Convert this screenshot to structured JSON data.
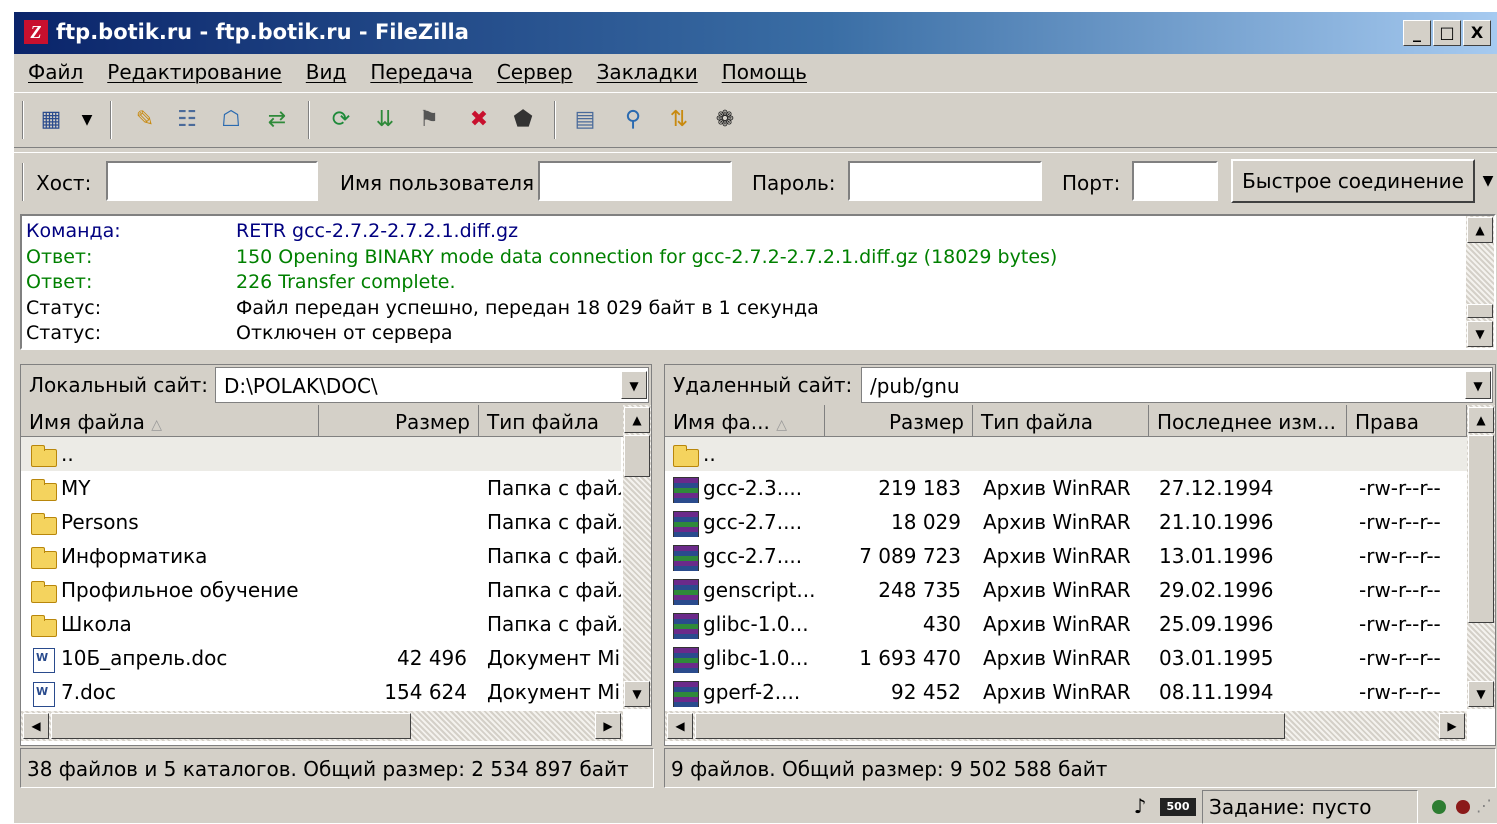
{
  "window": {
    "title": "ftp.botik.ru - ftp.botik.ru - FileZilla",
    "app_icon": "Z",
    "minimize": "_",
    "maximize": "□",
    "close": "X"
  },
  "menu": [
    "Файл",
    "Редактирование",
    "Вид",
    "Передача",
    "Сервер",
    "Закладки",
    "Помощь"
  ],
  "toolbar_icons": [
    "site-manager-icon",
    "dropdown-arrow-icon",
    "toggle-log-icon",
    "toggle-tree-icon",
    "toggle-remote-tree-icon",
    "toggle-queue-icon",
    "refresh-icon",
    "process-queue-icon",
    "cancel-icon",
    "disconnect-icon",
    "reconnect-icon",
    "filter-icon",
    "compare-icon",
    "sync-browse-icon",
    "search-icon"
  ],
  "quickconnect": {
    "host_label": "Хост:",
    "host_value": "",
    "user_label": "Имя пользователя",
    "user_value": "",
    "pass_label": "Пароль:",
    "pass_value": "",
    "port_label": "Порт:",
    "port_value": "",
    "button": "Быстрое соединение"
  },
  "log": [
    {
      "label": "Команда:",
      "msg": "RETR gcc-2.7.2-2.7.2.1.diff.gz",
      "color": "#000080"
    },
    {
      "label": "Ответ:",
      "msg": "150 Opening BINARY mode data connection for gcc-2.7.2-2.7.2.1.diff.gz (18029 bytes)",
      "color": "#008000"
    },
    {
      "label": "Ответ:",
      "msg": "226 Transfer complete.",
      "color": "#008000"
    },
    {
      "label": "Статус:",
      "msg": "Файл передан успешно, передан 18 029 байт в 1 секунда",
      "color": "#000000"
    },
    {
      "label": "Статус:",
      "msg": "Отключен от сервера",
      "color": "#000000"
    }
  ],
  "local": {
    "site_label": "Локальный сайт:",
    "path": "D:\\POLAK\\DOC\\",
    "columns": [
      "Имя файла",
      "Размер",
      "Тип файла"
    ],
    "rows": [
      {
        "icon": "folder",
        "name": "..",
        "size": "",
        "type": ""
      },
      {
        "icon": "folder",
        "name": "MY",
        "size": "",
        "type": "Папка с файл"
      },
      {
        "icon": "folder",
        "name": "Persons",
        "size": "",
        "type": "Папка с файл"
      },
      {
        "icon": "folder",
        "name": "Информатика",
        "size": "",
        "type": "Папка с файл"
      },
      {
        "icon": "folder",
        "name": "Профильное обучение",
        "size": "",
        "type": "Папка с файл"
      },
      {
        "icon": "folder",
        "name": "Школа",
        "size": "",
        "type": "Папка с файл"
      },
      {
        "icon": "doc",
        "name": "10Б_апрель.doc",
        "size": "42 496",
        "type": "Документ Mic"
      },
      {
        "icon": "doc",
        "name": "7.doc",
        "size": "154 624",
        "type": "Документ Mic"
      }
    ],
    "status": "38 файлов и 5 каталогов. Общий размер: 2 534 897 байт"
  },
  "remote": {
    "site_label": "Удаленный сайт:",
    "path": "/pub/gnu",
    "columns": [
      "Имя фа...",
      "Размер",
      "Тип файла",
      "Последнее изм...",
      "Права"
    ],
    "rows": [
      {
        "icon": "folder",
        "name": "..",
        "size": "",
        "type": "",
        "modified": "",
        "perms": ""
      },
      {
        "icon": "rar",
        "name": "gcc-2.3....",
        "size": "219 183",
        "type": "Архив WinRAR",
        "modified": "27.12.1994",
        "perms": "-rw-r--r--"
      },
      {
        "icon": "rar",
        "name": "gcc-2.7....",
        "size": "18 029",
        "type": "Архив WinRAR",
        "modified": "21.10.1996",
        "perms": "-rw-r--r--"
      },
      {
        "icon": "rar",
        "name": "gcc-2.7....",
        "size": "7 089 723",
        "type": "Архив WinRAR",
        "modified": "13.01.1996",
        "perms": "-rw-r--r--"
      },
      {
        "icon": "rar",
        "name": "genscript...",
        "size": "248 735",
        "type": "Архив WinRAR",
        "modified": "29.02.1996",
        "perms": "-rw-r--r--"
      },
      {
        "icon": "rar",
        "name": "glibc-1.0...",
        "size": "430",
        "type": "Архив WinRAR",
        "modified": "25.09.1996",
        "perms": "-rw-r--r--"
      },
      {
        "icon": "rar",
        "name": "glibc-1.0...",
        "size": "1 693 470",
        "type": "Архив WinRAR",
        "modified": "03.01.1995",
        "perms": "-rw-r--r--"
      },
      {
        "icon": "rar",
        "name": "gperf-2....",
        "size": "92 452",
        "type": "Архив WinRAR",
        "modified": "08.11.1994",
        "perms": "-rw-r--r--"
      }
    ],
    "status": "9 файлов. Общий размер: 9 502 588 байт"
  },
  "bottom": {
    "queue": "Задание: пусто",
    "speed_badge": "500",
    "colors": {
      "green_led": "#2e7d32",
      "red_led": "#8b1a1a"
    }
  }
}
